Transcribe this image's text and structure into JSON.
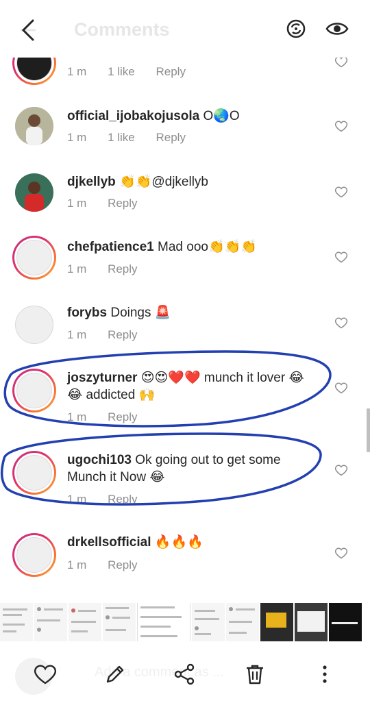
{
  "header": {
    "title": "Comments",
    "back_icon": "chevron-left-icon",
    "repost_icon": "repost-icon",
    "view_icon": "eye-icon"
  },
  "comments": [
    {
      "username": "",
      "text": "",
      "time": "1 m",
      "likes": "1 like",
      "reply": "Reply"
    },
    {
      "username": "official_ijobakojusola",
      "text": "O🌏O",
      "time": "1 m",
      "likes": "1 like",
      "reply": "Reply"
    },
    {
      "username": "djkellyb",
      "text": "👏👏@djkellyb",
      "time": "1 m",
      "likes": "",
      "reply": "Reply"
    },
    {
      "username": "chefpatience1",
      "text": "Mad ooo👏👏👏",
      "time": "1 m",
      "likes": "",
      "reply": "Reply"
    },
    {
      "username": "forybs",
      "text": "Doings 🚨",
      "time": "1 m",
      "likes": "",
      "reply": "Reply"
    },
    {
      "username": "joszyturner",
      "text": "😍😍❤️❤️ munch it lover 😂😂 addicted 🙌",
      "time": "1 m",
      "likes": "",
      "reply": "Reply"
    },
    {
      "username": "ugochi103",
      "text": "Ok going out to get some Munch it  Now 😂",
      "time": "1 m",
      "likes": "",
      "reply": "Reply"
    },
    {
      "username": "drkellsofficial",
      "text": "🔥🔥🔥",
      "time": "1 m",
      "likes": "",
      "reply": "Reply"
    }
  ],
  "bottom_bar": {
    "placeholder": "Add a comment as ...",
    "icons": [
      "heart-icon",
      "edit-icon",
      "share-icon",
      "trash-icon",
      "more-icon"
    ]
  }
}
